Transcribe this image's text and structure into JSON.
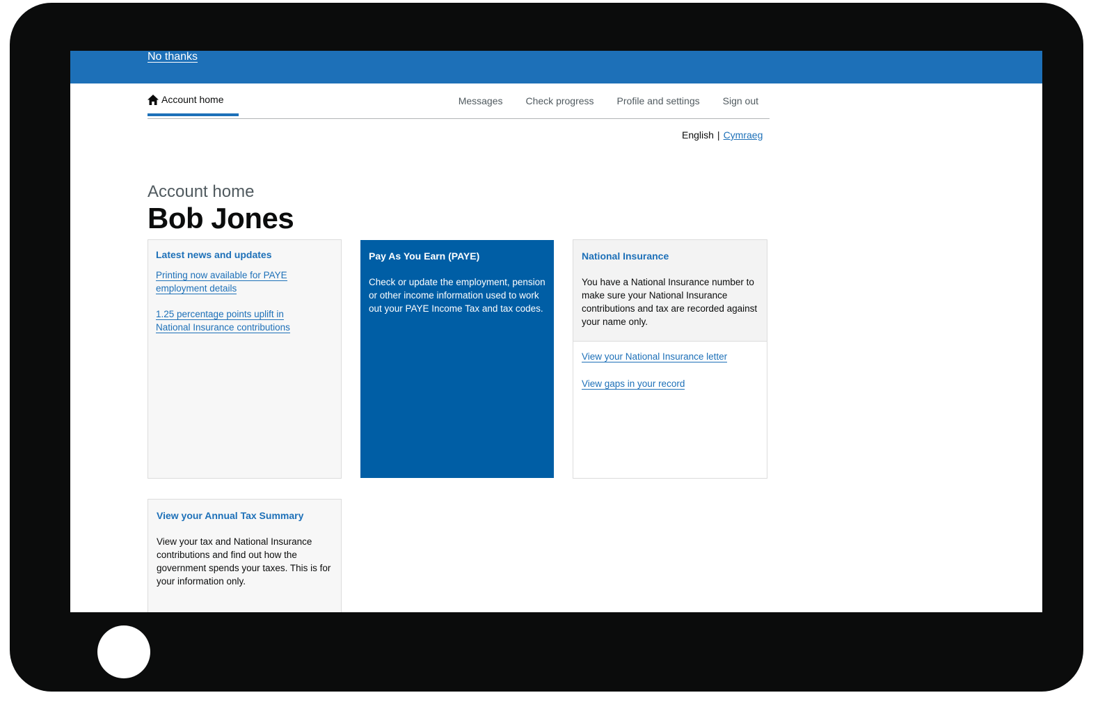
{
  "banner": {
    "no_thanks": "No thanks"
  },
  "nav": {
    "home_label": "Account home",
    "items": [
      "Messages",
      "Check progress",
      "Profile and settings",
      "Sign out"
    ]
  },
  "language": {
    "current": "English",
    "separator": "|",
    "other": "Cymraeg"
  },
  "heading": {
    "caption": "Account home",
    "name": "Bob Jones"
  },
  "cards": {
    "news": {
      "title": "Latest news and updates",
      "links": [
        "Printing now available for PAYE employment details",
        "1.25 percentage points uplift in National Insurance contributions"
      ]
    },
    "paye": {
      "title": "Pay As You Earn (PAYE)",
      "body": "Check or update the employment, pension or other income information used to work out your PAYE Income Tax and tax codes."
    },
    "ni": {
      "title": "National Insurance",
      "body": "You have a National Insurance number to make sure your National Insurance contributions and tax are recorded against your name only.",
      "links": [
        "View your National Insurance letter",
        "View gaps in your record"
      ]
    },
    "ats": {
      "title": "View your Annual Tax Summary",
      "body": "View your tax and National Insurance contributions and find out how the government spends your taxes. This is for your information only."
    }
  },
  "colors": {
    "brand_blue": "#1d70b8",
    "paye_blue": "#005ea5",
    "device_frame": "#0b0c0c"
  }
}
